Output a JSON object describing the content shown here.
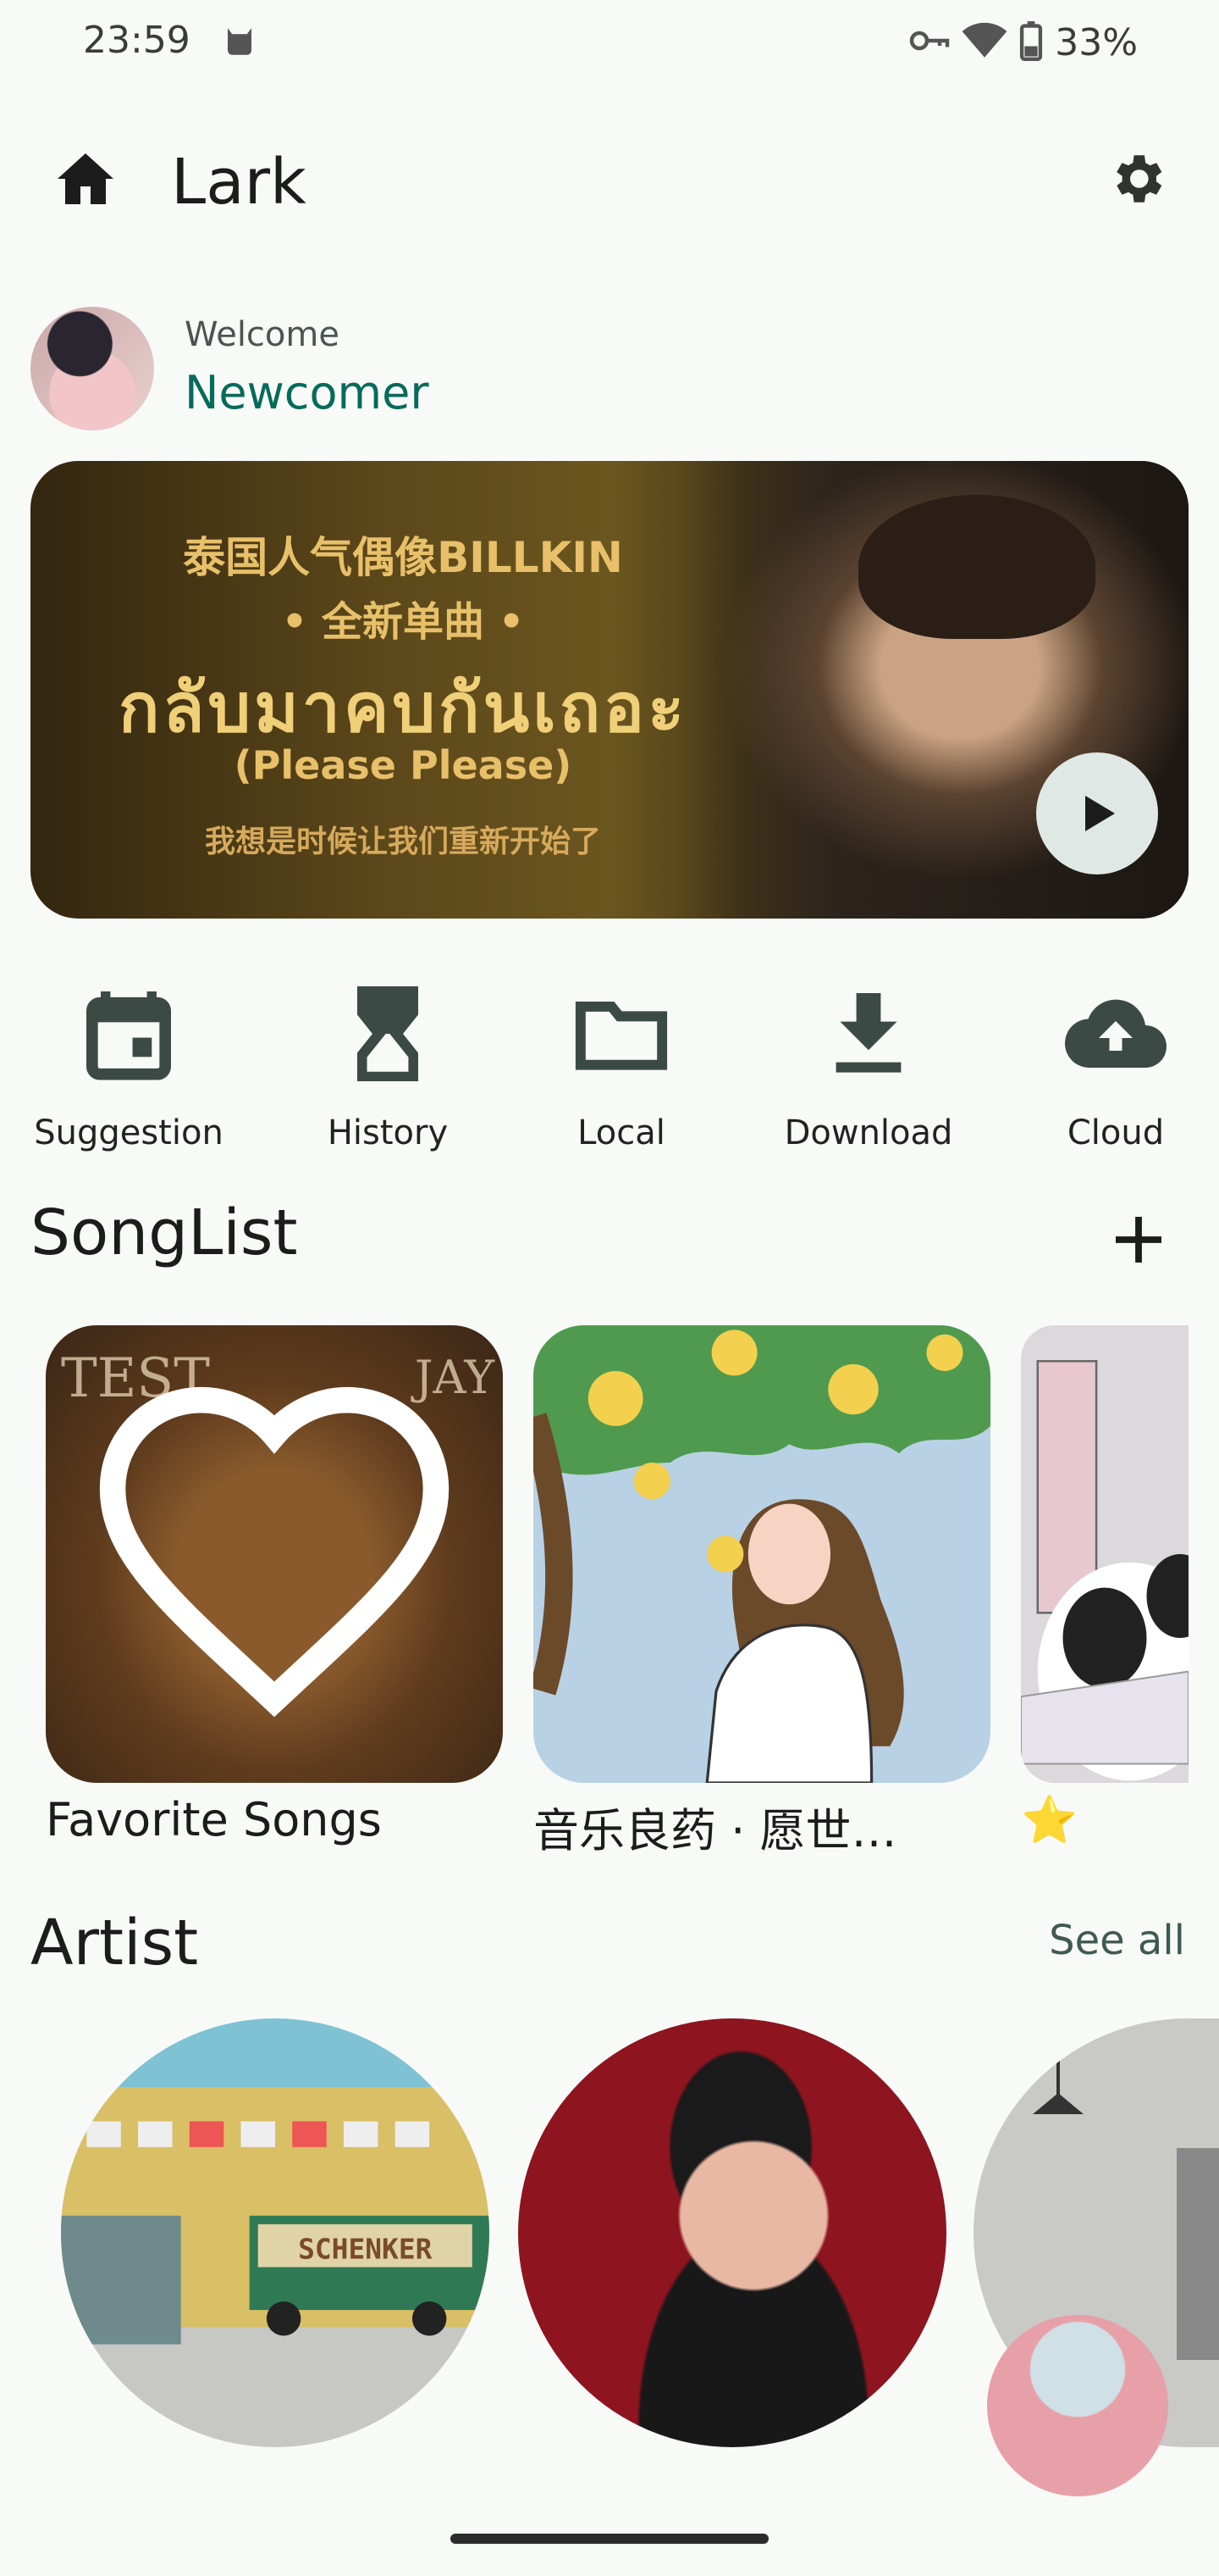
{
  "status_bar": {
    "time": "23:59",
    "battery": "33%"
  },
  "top_bar": {
    "title": "Lark"
  },
  "welcome": {
    "label": "Welcome",
    "name": "Newcomer"
  },
  "banner": {
    "line1": "泰国人气偶像BILLKIN",
    "line2": "• 全新单曲 •",
    "line3": "กลับมาคบกันเถอะ",
    "line4": "(Please Please)",
    "line5": "我想是时候让我们重新开始了"
  },
  "shortcuts": [
    {
      "label": "Suggestion",
      "icon": "calendar-icon"
    },
    {
      "label": "History",
      "icon": "hourglass-icon"
    },
    {
      "label": "Local",
      "icon": "folder-icon"
    },
    {
      "label": "Download",
      "icon": "download-icon"
    },
    {
      "label": "Cloud",
      "icon": "cloud-upload-icon"
    }
  ],
  "songlist": {
    "title": "SongList",
    "cards": [
      {
        "title": "Favorite Songs"
      },
      {
        "title": "音乐良药 · 愿世…"
      },
      {
        "title": "⭐"
      }
    ],
    "cover1_text_left": "TEST",
    "cover1_text_right": "JAY"
  },
  "artist": {
    "title": "Artist",
    "see_all": "See all",
    "truck_label": "SCHENKER"
  },
  "colors": {
    "accent": "#066b5a",
    "icon": "#3c4a45",
    "background": "#f8faf8"
  }
}
